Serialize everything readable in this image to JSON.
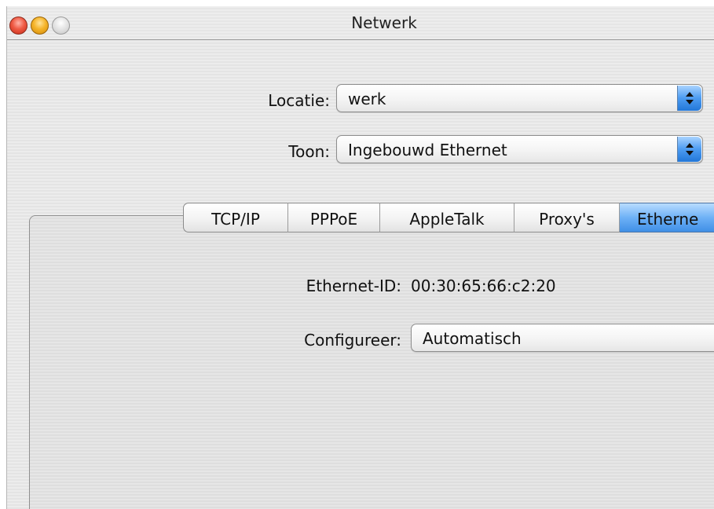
{
  "window": {
    "title": "Netwerk"
  },
  "location": {
    "label": "Locatie:",
    "value": "werk"
  },
  "show": {
    "label": "Toon:",
    "value": "Ingebouwd Ethernet"
  },
  "tabs": [
    {
      "label": "TCP/IP"
    },
    {
      "label": "PPPoE"
    },
    {
      "label": "AppleTalk"
    },
    {
      "label": "Proxy's"
    },
    {
      "label": "Etherne"
    }
  ],
  "ethernet": {
    "id_label": "Ethernet-ID:",
    "id_value": "00:30:65:66:c2:20",
    "configure_label": "Configureer:",
    "configure_value": "Automatisch"
  },
  "colors": {
    "active_tab": "#6eb1f6",
    "popup_arrows": "#4c9bf1"
  }
}
